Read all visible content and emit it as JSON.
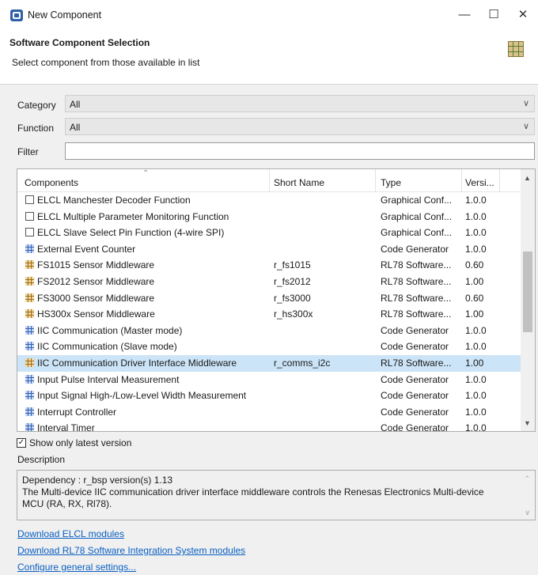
{
  "window": {
    "title": "New Component",
    "controls": {
      "minimize": "—",
      "maximize": "☐",
      "close": "✕"
    }
  },
  "header": {
    "title": "Software Component Selection",
    "subtitle": "Select component from those available in list",
    "icon": "component-grid-icon"
  },
  "form": {
    "category": {
      "label": "Category",
      "value": "All"
    },
    "function": {
      "label": "Function",
      "value": "All"
    },
    "filter": {
      "label": "Filter",
      "value": ""
    }
  },
  "table": {
    "columns": [
      "Components",
      "Short Name",
      "Type",
      "Versi..."
    ],
    "rows": [
      {
        "icon": "graphical-config-icon",
        "name": "ELCL Manchester Decoder Function",
        "short": "",
        "type": "Graphical Conf...",
        "version": "1.0.0"
      },
      {
        "icon": "graphical-config-icon",
        "name": "ELCL Multiple Parameter Monitoring Function",
        "short": "",
        "type": "Graphical Conf...",
        "version": "1.0.0"
      },
      {
        "icon": "graphical-config-icon",
        "name": "ELCL Slave Select Pin Function (4-wire SPI)",
        "short": "",
        "type": "Graphical Conf...",
        "version": "1.0.0"
      },
      {
        "icon": "code-generator-icon",
        "name": "External Event Counter",
        "short": "",
        "type": "Code Generator",
        "version": "1.0.0"
      },
      {
        "icon": "rl78-software-icon",
        "name": "FS1015 Sensor Middleware",
        "short": "r_fs1015",
        "type": "RL78 Software...",
        "version": "0.60"
      },
      {
        "icon": "rl78-software-icon",
        "name": "FS2012 Sensor Middleware",
        "short": "r_fs2012",
        "type": "RL78 Software...",
        "version": "1.00"
      },
      {
        "icon": "rl78-software-icon",
        "name": "FS3000 Sensor Middleware",
        "short": "r_fs3000",
        "type": "RL78 Software...",
        "version": "0.60"
      },
      {
        "icon": "rl78-software-icon",
        "name": "HS300x Sensor Middleware",
        "short": "r_hs300x",
        "type": "RL78 Software...",
        "version": "1.00"
      },
      {
        "icon": "code-generator-icon",
        "name": "IIC Communication (Master mode)",
        "short": "",
        "type": "Code Generator",
        "version": "1.0.0"
      },
      {
        "icon": "code-generator-icon",
        "name": "IIC Communication (Slave mode)",
        "short": "",
        "type": "Code Generator",
        "version": "1.0.0"
      },
      {
        "icon": "rl78-software-icon",
        "name": "IIC Communication Driver Interface Middleware",
        "short": "r_comms_i2c",
        "type": "RL78 Software...",
        "version": "1.00",
        "selected": true
      },
      {
        "icon": "code-generator-icon",
        "name": "Input Pulse Interval Measurement",
        "short": "",
        "type": "Code Generator",
        "version": "1.0.0"
      },
      {
        "icon": "code-generator-icon",
        "name": "Input Signal High-/Low-Level Width Measurement",
        "short": "",
        "type": "Code Generator",
        "version": "1.0.0"
      },
      {
        "icon": "code-generator-icon",
        "name": "Interrupt Controller",
        "short": "",
        "type": "Code Generator",
        "version": "1.0.0"
      },
      {
        "icon": "code-generator-icon",
        "name": "Interval Timer",
        "short": "",
        "type": "Code Generator",
        "version": "1.0.0"
      }
    ]
  },
  "options": {
    "show_latest_label": "Show only latest version",
    "show_latest_checked": true
  },
  "description": {
    "label": "Description",
    "lines": [
      "Dependency : r_bsp version(s) 1.13",
      "The Multi-device IIC communication driver interface middleware controls the Renesas Electronics Multi-device",
      "MCU (RA, RX, Rl78)."
    ]
  },
  "links": [
    "Download ELCL modules",
    "Download RL78 Software Integration System modules",
    "Configure general settings..."
  ]
}
